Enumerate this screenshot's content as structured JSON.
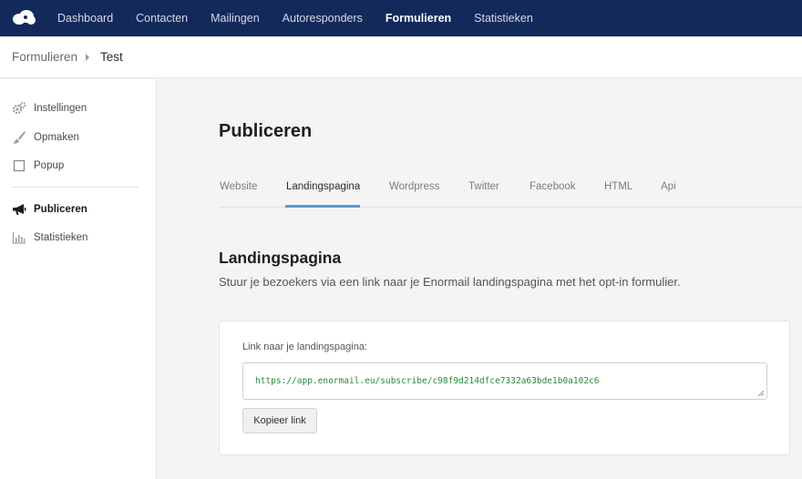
{
  "colors": {
    "nav_bg": "#12295a",
    "accent": "#5b9bd5",
    "link_green": "#2a8a3a"
  },
  "topnav": {
    "logo_icon": "cloud-logo-icon",
    "items": [
      {
        "label": "Dashboard",
        "active": false
      },
      {
        "label": "Contacten",
        "active": false
      },
      {
        "label": "Mailingen",
        "active": false
      },
      {
        "label": "Autoresponders",
        "active": false
      },
      {
        "label": "Formulieren",
        "active": true
      },
      {
        "label": "Statistieken",
        "active": false
      }
    ]
  },
  "breadcrumb": {
    "parent": "Formulieren",
    "current": "Test"
  },
  "sidebar": {
    "items": [
      {
        "label": "Instellingen",
        "icon": "gears-icon"
      },
      {
        "label": "Opmaken",
        "icon": "brush-icon"
      },
      {
        "label": "Popup",
        "icon": "square-icon"
      },
      {
        "label": "Publiceren",
        "icon": "megaphone-icon",
        "active": true
      },
      {
        "label": "Statistieken",
        "icon": "bar-chart-icon"
      }
    ]
  },
  "main": {
    "title": "Publiceren",
    "tabs": [
      {
        "label": "Website"
      },
      {
        "label": "Landingspagina",
        "active": true
      },
      {
        "label": "Wordpress"
      },
      {
        "label": "Twitter"
      },
      {
        "label": "Facebook"
      },
      {
        "label": "HTML"
      },
      {
        "label": "Api"
      }
    ],
    "section_title": "Landingspagina",
    "section_desc": "Stuur je bezoekers via een link naar je Enormail landingspagina met het opt-in formulier.",
    "card": {
      "label": "Link naar je landingspagina:",
      "link": "https://app.enormail.eu/subscribe/c98f9d214dfce7332a63bde1b0a102c6",
      "copy_button": "Kopieer link"
    }
  }
}
